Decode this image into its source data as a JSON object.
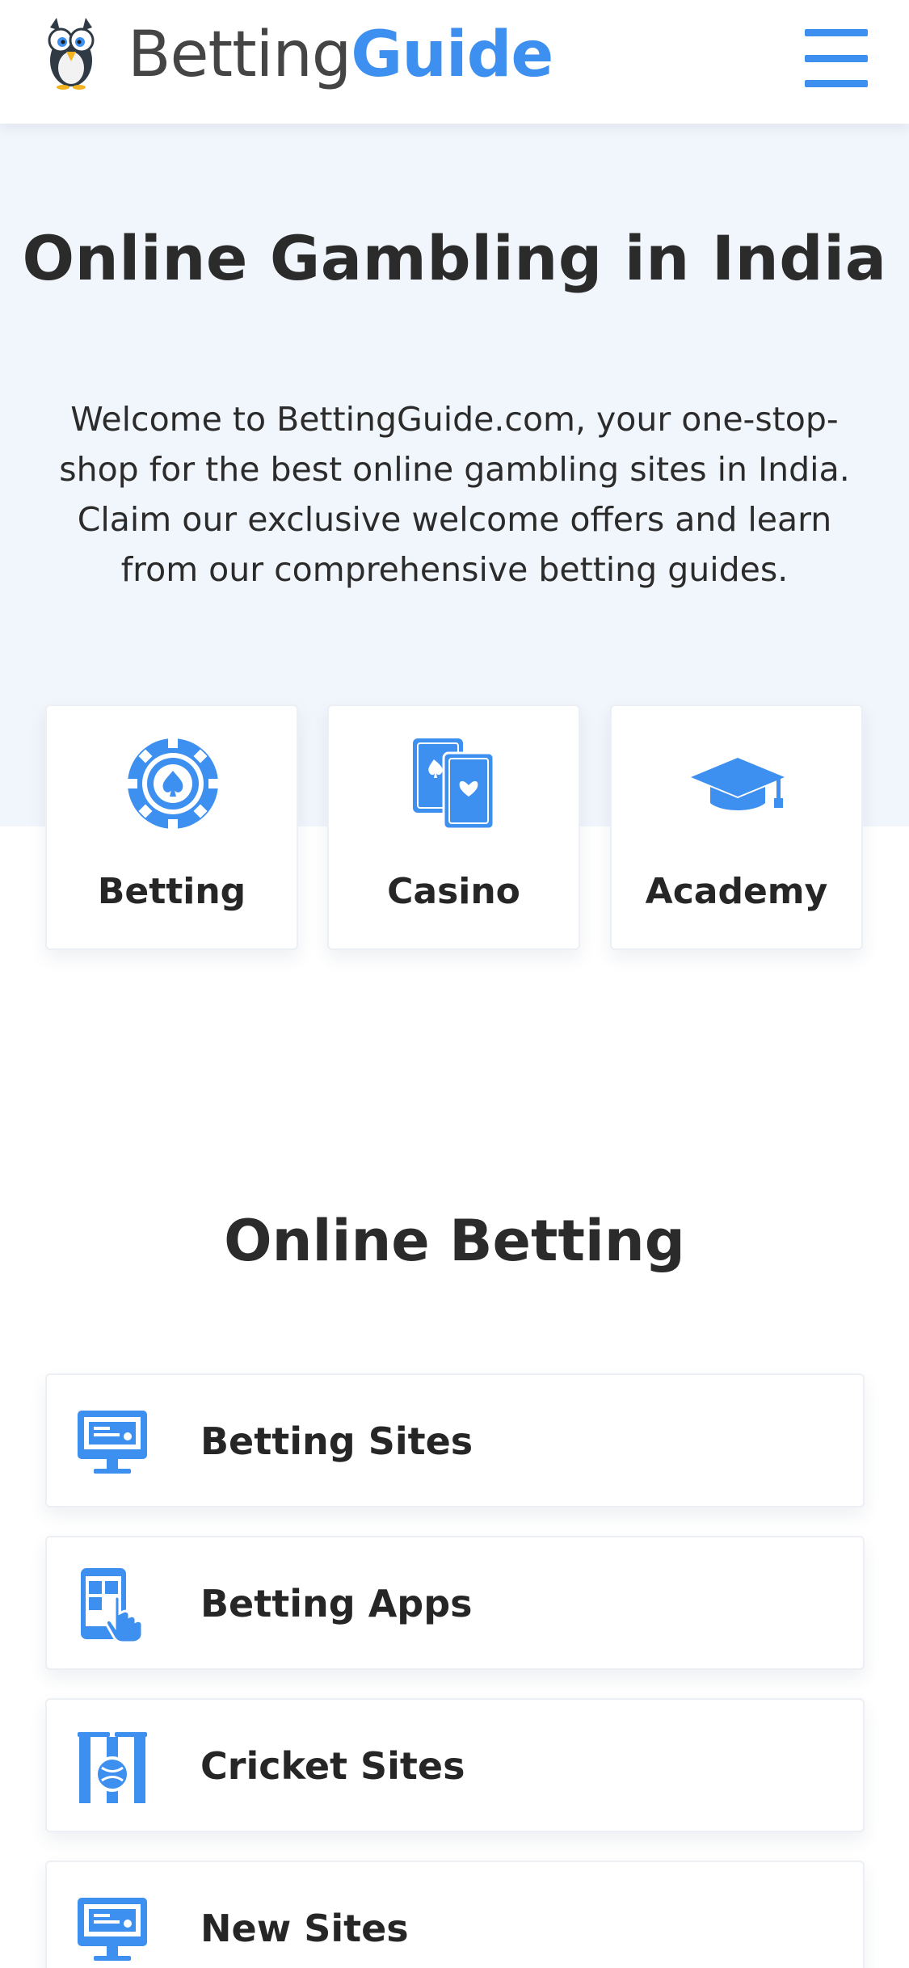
{
  "header": {
    "brand_part_1": "Betting",
    "brand_part_2": "Guide",
    "menu_icon": "hamburger-menu-icon",
    "accent_color": "#3d8ff0"
  },
  "hero": {
    "title": "Online Gambling in India",
    "intro": "Welcome to BettingGuide.com, your one-stop-shop for the best online gambling sites in India. Claim our exclusive welcome offers and learn from our comprehensive betting guides."
  },
  "categories": [
    {
      "label": "Betting",
      "icon": "poker-chip-icon"
    },
    {
      "label": "Casino",
      "icon": "playing-cards-icon"
    },
    {
      "label": "Academy",
      "icon": "graduation-cap-icon"
    }
  ],
  "online_betting": {
    "title": "Online Betting",
    "items": [
      {
        "label": "Betting Sites",
        "icon": "desktop-monitor-icon"
      },
      {
        "label": "Betting Apps",
        "icon": "mobile-tap-icon"
      },
      {
        "label": "Cricket Sites",
        "icon": "cricket-wickets-icon"
      },
      {
        "label": "New Sites",
        "icon": "desktop-monitor-icon"
      }
    ]
  }
}
